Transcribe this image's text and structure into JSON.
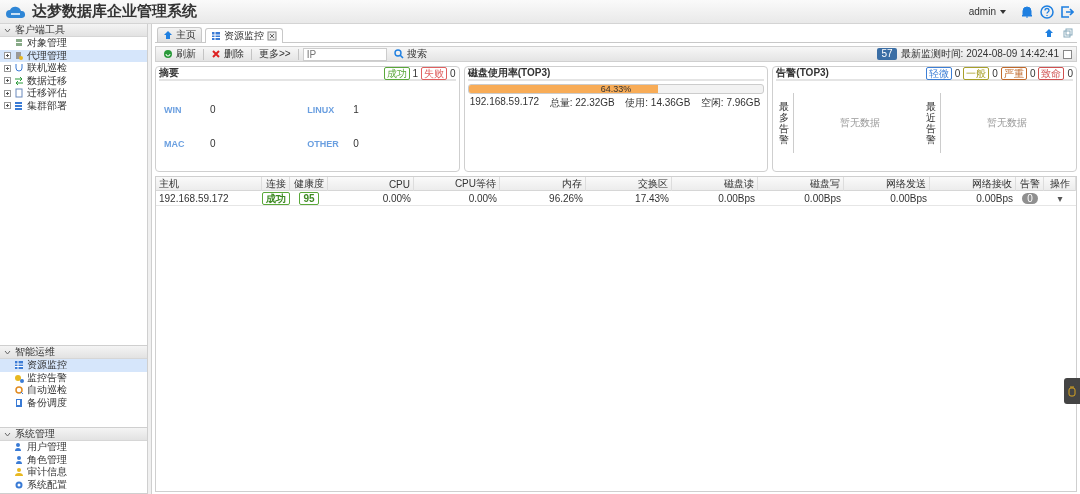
{
  "header": {
    "title": "达梦数据库企业管理系统",
    "user": "admin"
  },
  "sidebar": {
    "sections": [
      {
        "title": "客户端工具",
        "expanded": true,
        "items": [
          {
            "label": "对象管理",
            "kind": "leaf",
            "selected": false
          },
          {
            "label": "代理管理",
            "kind": "node",
            "expanded": false,
            "selected": true
          },
          {
            "label": "联机巡检",
            "kind": "node",
            "expanded": false,
            "selected": false
          },
          {
            "label": "数据迁移",
            "kind": "node",
            "expanded": false,
            "selected": false
          },
          {
            "label": "迁移评估",
            "kind": "node",
            "expanded": false,
            "selected": false
          },
          {
            "label": "集群部署",
            "kind": "node",
            "expanded": false,
            "selected": false
          }
        ]
      },
      {
        "title": "智能运维",
        "expanded": true,
        "items": [
          {
            "label": "资源监控",
            "kind": "leaf",
            "selected": true
          },
          {
            "label": "监控告警",
            "kind": "leaf",
            "selected": false
          },
          {
            "label": "自动巡检",
            "kind": "leaf",
            "selected": false
          },
          {
            "label": "备份调度",
            "kind": "leaf",
            "selected": false
          }
        ]
      },
      {
        "title": "系统管理",
        "expanded": true,
        "items": [
          {
            "label": "用户管理",
            "kind": "leaf",
            "selected": false
          },
          {
            "label": "角色管理",
            "kind": "leaf",
            "selected": false
          },
          {
            "label": "审计信息",
            "kind": "leaf",
            "selected": false
          },
          {
            "label": "系统配置",
            "kind": "leaf",
            "selected": false
          }
        ]
      }
    ]
  },
  "tabs": [
    {
      "label": "主页",
      "selected": false,
      "closable": false
    },
    {
      "label": "资源监控",
      "selected": true,
      "closable": true
    }
  ],
  "toolbar": {
    "buttons": [
      "刷新",
      "删除",
      "更多>>"
    ],
    "search": {
      "placeholder": "IP",
      "button": "搜索"
    },
    "count": "57",
    "last_check": "最新监测时间: 2024-08-09 14:42:41",
    "checked": false
  },
  "summary": {
    "title": "摘要",
    "badges": [
      {
        "label": "成功",
        "count": "1",
        "color": "#5aa83a"
      },
      {
        "label": "失败",
        "count": "0",
        "color": "#e06060"
      }
    ],
    "stats": [
      {
        "name": "WIN",
        "value": "0"
      },
      {
        "name": "LINUX",
        "value": "1"
      },
      {
        "name": "MAC",
        "value": "0"
      },
      {
        "name": "OTHER",
        "value": "0"
      }
    ]
  },
  "disk": {
    "title": "磁盘使用率(TOP3)",
    "bars": [
      {
        "percent": "64.33%",
        "level": 0.6433,
        "host": "192.168.59.172",
        "total": "总量: 22.32GB",
        "used": "使用: 14.36GB",
        "free": "空闲: 7.96GB"
      }
    ]
  },
  "alarms": {
    "title": "告警(TOP3)",
    "badges": [
      {
        "label": "轻微",
        "count": "0",
        "color": "#3d7fd6"
      },
      {
        "label": "一般",
        "count": "0",
        "color": "#a8a02a"
      },
      {
        "label": "严重",
        "count": "0",
        "color": "#c0682a"
      },
      {
        "label": "致命",
        "count": "0",
        "color": "#d05050"
      }
    ],
    "columns": [
      {
        "label": "最多告警",
        "empty": "暂无数据"
      },
      {
        "label": "最近告警",
        "empty": "暂无数据"
      }
    ]
  },
  "table": {
    "columns": [
      "主机",
      "连接",
      "健康度",
      "CPU",
      "CPU等待",
      "内存",
      "交换区",
      "磁盘读",
      "磁盘写",
      "网络发送",
      "网络接收",
      "告警",
      "操作"
    ],
    "rows": [
      {
        "cells": [
          {
            "kind": "text",
            "text": "192.168.59.172"
          },
          {
            "kind": "badge",
            "text": "成功"
          },
          {
            "kind": "badge",
            "text": "95"
          },
          {
            "kind": "num",
            "text": "0.00%"
          },
          {
            "kind": "num",
            "text": "0.00%"
          },
          {
            "kind": "num",
            "text": "96.26%"
          },
          {
            "kind": "num",
            "text": "17.43%"
          },
          {
            "kind": "num",
            "text": "0.00Bps"
          },
          {
            "kind": "num",
            "text": "0.00Bps"
          },
          {
            "kind": "num",
            "text": "0.00Bps"
          },
          {
            "kind": "num",
            "text": "0.00Bps"
          },
          {
            "kind": "pill",
            "text": "0"
          },
          {
            "kind": "menu",
            "text": "▾"
          }
        ]
      }
    ]
  }
}
